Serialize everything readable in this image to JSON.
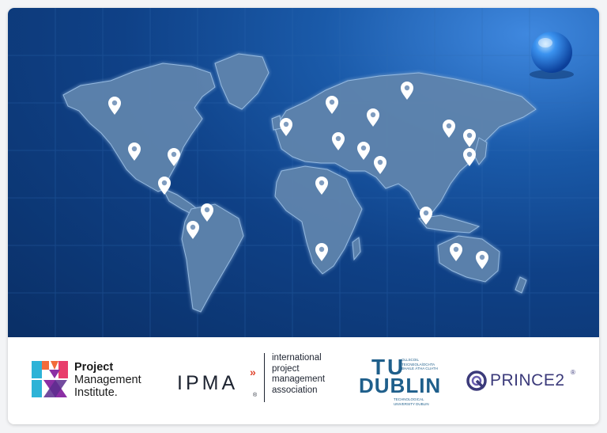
{
  "map": {
    "background": "#0f4187",
    "land_color": "#5f84ad",
    "pin_color": "#ffffff",
    "pin_icon": "location-pin-icon",
    "globe_icon": "globe-sphere-icon"
  },
  "logos": {
    "pmi": {
      "line1": "Project",
      "line2": "Management",
      "line3": "Institute."
    },
    "ipma": {
      "wordmark": "IPMA",
      "chevron": "»",
      "dot": "®",
      "lines": [
        "international",
        "project",
        "management",
        "association"
      ]
    },
    "tu_dublin": {
      "t": "T",
      "u": "U",
      "wordmark": "DUBLIN",
      "irish_lines": [
        "OLLSCOIL TEICNEOLAÍOCHTA",
        "BHAILE ÁTHA CLIATH"
      ],
      "english_lines": [
        "TECHNOLOGICAL",
        "UNIVERSITY DUBLIN"
      ]
    },
    "prince2": {
      "wordmark": "PRINCE2",
      "reg": "®"
    }
  }
}
